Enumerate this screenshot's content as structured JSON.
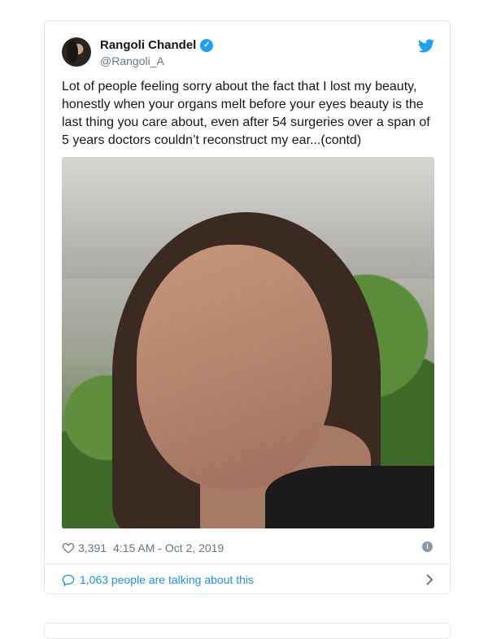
{
  "tweet": {
    "author": {
      "display_name": "Rangoli Chandel",
      "handle": "@Rangoli_A",
      "verified_icon": "verified-check-icon"
    },
    "text": "Lot of people feeling sorry about the fact that I lost my beauty, honestly when your organs melt before your eyes beauty is the last thing you care about, even after 54 surgeries over a span of 5 years doctors couldn’t reconstruct my ear...(contd)",
    "meta": {
      "likes": "3,391",
      "timestamp": "4:15 AM - Oct 2, 2019"
    },
    "talk_link": "1,063 people are talking about this"
  },
  "colors": {
    "accent": "#1da1f2",
    "text": "#14171a",
    "muted": "#657786",
    "link": "#1b95e0"
  }
}
